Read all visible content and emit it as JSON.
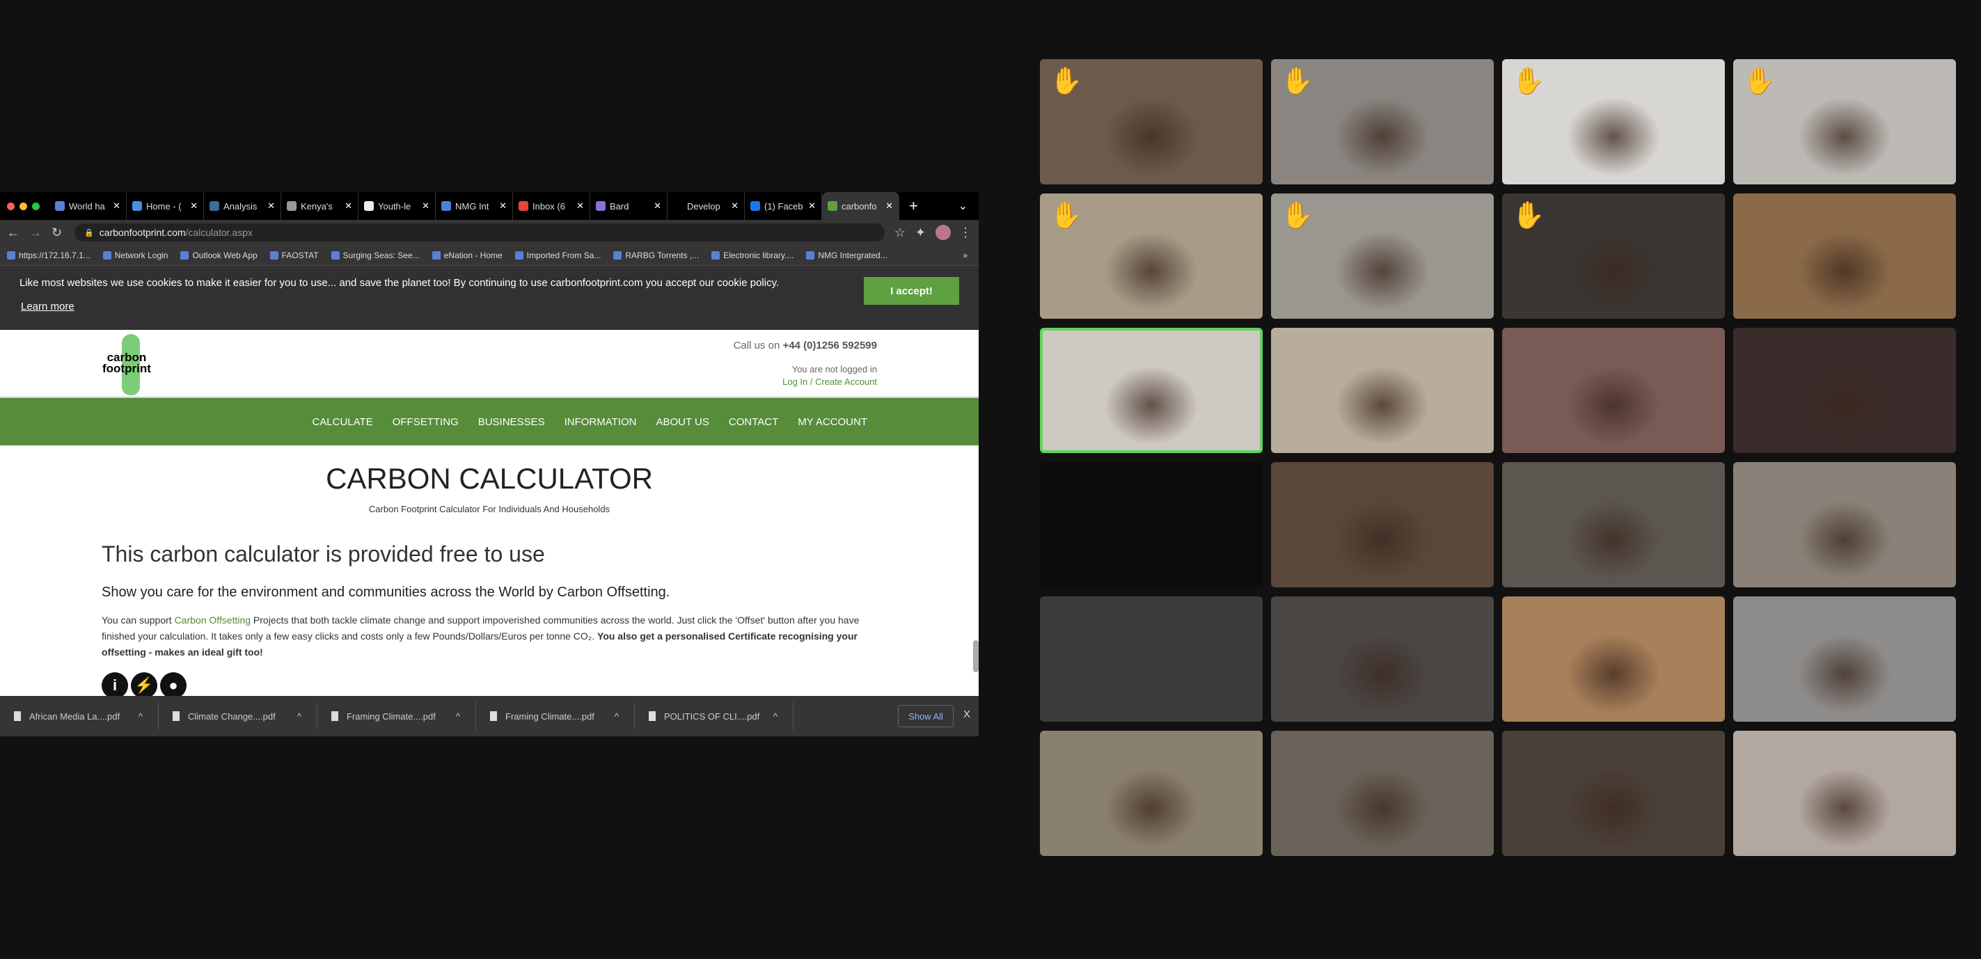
{
  "browser": {
    "tabs": [
      {
        "label": "World ha",
        "color": "#5b7fd6"
      },
      {
        "label": "Home - (",
        "color": "#4a90e2"
      },
      {
        "label": "Analysis",
        "color": "#3d6b9a"
      },
      {
        "label": "Kenya's",
        "color": "#999999"
      },
      {
        "label": "Youth-le",
        "color": "#eeeeee"
      },
      {
        "label": "NMG Int",
        "color": "#4a7fe0"
      },
      {
        "label": "Inbox (6",
        "color": "#ea4335"
      },
      {
        "label": "Bard",
        "color": "#8a6fd6"
      },
      {
        "label": "Develop",
        "color": "#000000"
      },
      {
        "label": "(1) Faceb",
        "color": "#1877f2"
      },
      {
        "label": "carbonfo",
        "color": "#5fa040",
        "active": true
      }
    ],
    "new_tab": "+",
    "tab_menu": "⌄",
    "url_host": "carbonfootprint.com",
    "url_path": "/calculator.aspx",
    "bookmarks": [
      "https://172.16.7.1...",
      "Network Login",
      "Outlook Web App",
      "FAOSTAT",
      "Surging Seas: See...",
      "eNation - Home",
      "Imported From Sa...",
      "RARBG Torrents ,...",
      "Electronic library....",
      "NMG Intergrated..."
    ],
    "bookmarks_more": "»"
  },
  "cookie": {
    "message": "Like most websites we use cookies to make it easier for you to use... and save the planet too! By continuing to use carbonfootprint.com you accept our cookie policy.",
    "learn_more": "Learn more",
    "accept": "I accept!"
  },
  "site": {
    "logo": "carbon footprint™",
    "call_prefix": "Call us on ",
    "phone": "+44 (0)1256 592599",
    "not_logged": "You are not logged in",
    "login": "Log In / Create Account",
    "nav": [
      "CALCULATE",
      "OFFSETTING",
      "BUSINESSES",
      "INFORMATION",
      "ABOUT US",
      "CONTACT",
      "MY ACCOUNT"
    ],
    "title": "CARBON CALCULATOR",
    "subtitle": "Carbon Footprint Calculator For Individuals And Households",
    "h2": "This carbon calculator is provided free to use",
    "h3": "Show you care for the environment and communities across the World by Carbon Offsetting.",
    "p1": "You can support ",
    "p_link": "Carbon Offsetting",
    "p2": " Projects that both tackle climate change and support impoverished communities across the world. Just click the 'Offset' button after you have finished your calculation. It takes only a few easy clicks and costs only a few Pounds/Dollars/Euros per tonne CO₂. ",
    "p_bold": "You also get a personalised Certificate recognising your offsetting - makes an ideal gift too!",
    "icons": [
      "i",
      "⚡",
      "●"
    ]
  },
  "downloads": {
    "files": [
      "African Media La....pdf",
      "Climate Change....pdf",
      "Framing Climate....pdf",
      "Framing Climate....pdf",
      "POLITICS OF CLI....pdf"
    ],
    "show_all": "Show All",
    "close": "X"
  },
  "video_grid": {
    "tiles": [
      {
        "hand": true,
        "bg": "#6e5a4c"
      },
      {
        "hand": true,
        "bg": "#8a8580"
      },
      {
        "hand": true,
        "bg": "#d8d6d2"
      },
      {
        "hand": true,
        "bg": "#bdbab5"
      },
      {
        "hand": true,
        "bg": "#a89c88"
      },
      {
        "hand": true,
        "bg": "#9a9690"
      },
      {
        "hand": true,
        "bg": "#3a3633"
      },
      {
        "hand": false,
        "bg": "#8a6a48"
      },
      {
        "hand": false,
        "bg": "#cfc9c4",
        "speaking": true
      },
      {
        "hand": false,
        "bg": "#b8ad9c"
      },
      {
        "hand": false,
        "bg": "#7a5a55"
      },
      {
        "hand": false,
        "bg": "#3a2c2a"
      },
      {
        "hand": false,
        "bg": "#0c0c0c"
      },
      {
        "hand": false,
        "bg": "#5a463a"
      },
      {
        "hand": false,
        "bg": "#5c5650"
      },
      {
        "hand": false,
        "bg": "#8a8278"
      },
      {
        "hand": false,
        "bg": "#3c3c3c"
      },
      {
        "hand": false,
        "bg": "#4a4644"
      },
      {
        "hand": false,
        "bg": "#a8805a"
      },
      {
        "hand": false,
        "bg": "#8e8c8a"
      },
      {
        "hand": false,
        "bg": "#8a8070"
      },
      {
        "hand": false,
        "bg": "#6a6258"
      },
      {
        "hand": false,
        "bg": "#4a4038"
      },
      {
        "hand": false,
        "bg": "#b2a8a0"
      }
    ],
    "hand_icon": "✋"
  }
}
